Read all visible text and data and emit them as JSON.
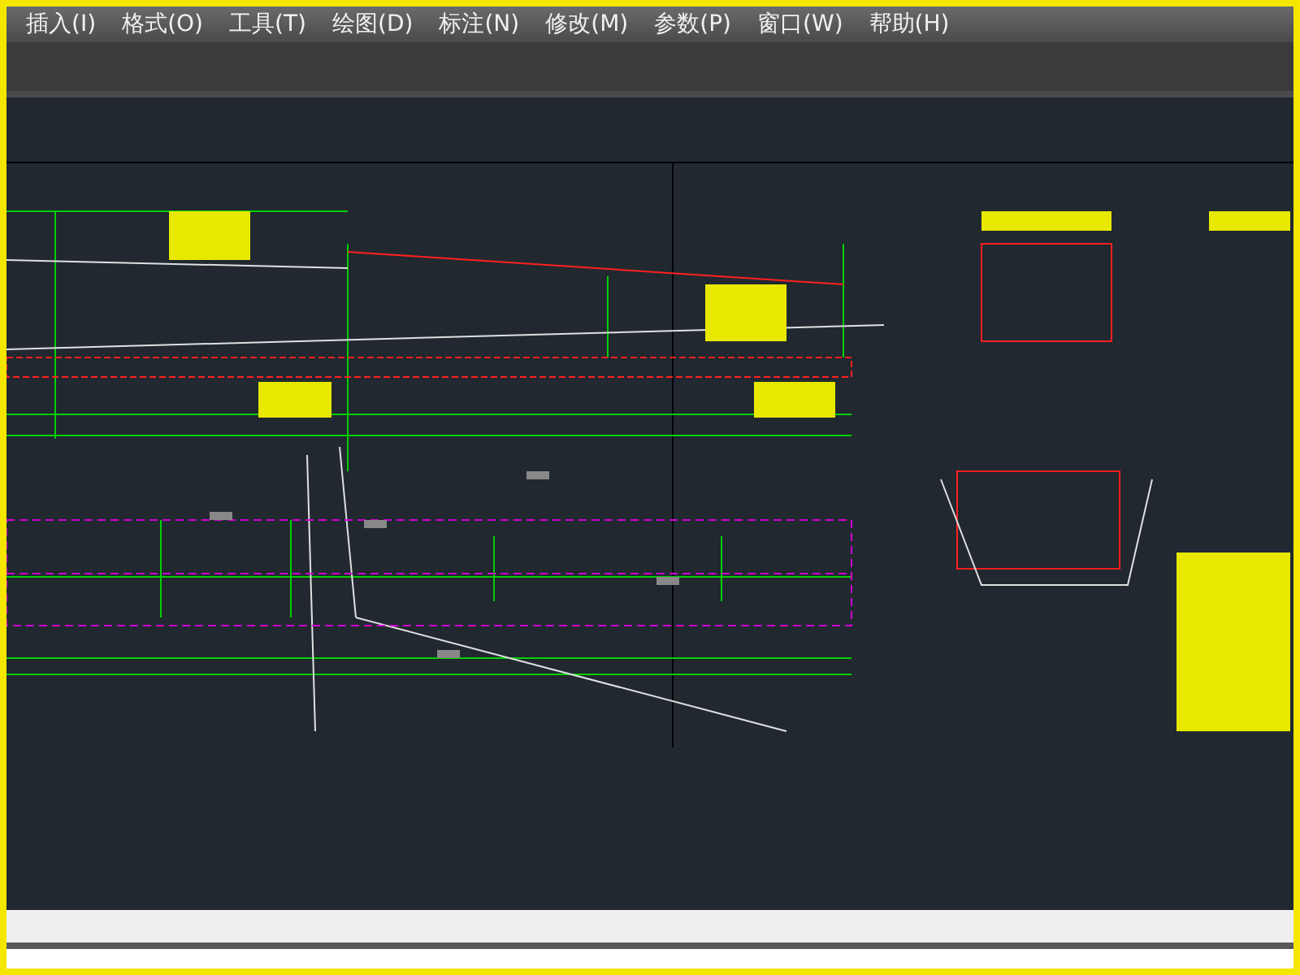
{
  "menu_bar": {
    "items": [
      "插入(I)",
      "格式(O)",
      "工具(T)",
      "绘图(D)",
      "标注(N)",
      "修改(M)",
      "参数(P)",
      "窗口(W)",
      "帮助(H)"
    ]
  }
}
